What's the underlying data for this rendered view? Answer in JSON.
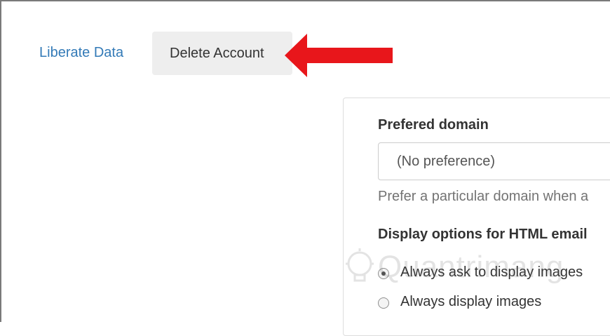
{
  "tabs": {
    "liberate_label": "Liberate Data",
    "delete_label": "Delete Account"
  },
  "preferred_domain": {
    "label": "Prefered domain",
    "selected_value": "(No preference)",
    "help_text": "Prefer a particular domain when a"
  },
  "display_options": {
    "label": "Display options for HTML email",
    "options": [
      {
        "label": "Always ask to display images",
        "selected": true
      },
      {
        "label": "Always display images",
        "selected": false
      }
    ]
  },
  "annotation": {
    "arrow_color": "#e8161b",
    "arrow_icon": "red-arrow-left-icon"
  },
  "watermark": {
    "brand": "Quantrimang",
    "icon": "lightbulb-icon"
  },
  "colors": {
    "link": "#337ab7",
    "active_tab_bg": "#eeeeee",
    "text": "#333333",
    "muted": "#737373"
  }
}
